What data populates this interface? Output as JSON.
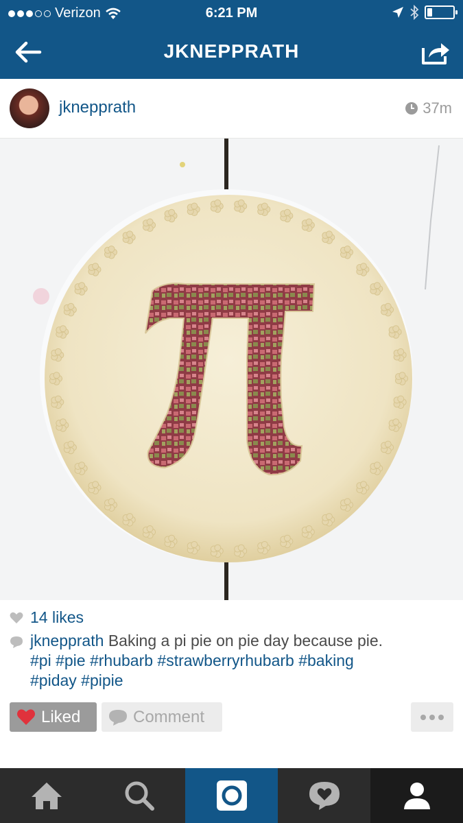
{
  "status_bar": {
    "carrier": "Verizon",
    "time": "6:21 PM",
    "signal_bars_filled": 3,
    "signal_bars_total": 5,
    "battery_level": 0.2
  },
  "nav": {
    "title": "JKNEPPRATH",
    "back_icon": "back-arrow-icon",
    "share_icon": "share-icon"
  },
  "post": {
    "username": "jknepprath",
    "time_ago": "37m",
    "likes": "14 likes",
    "caption": {
      "user": "jknepprath",
      "text": "Baking a pi pie on pie day because pie.",
      "hashtags_line1": "#pi #pie #rhubarb #strawberryrhubarb #baking",
      "hashtags_line2": "#piday #pipie"
    }
  },
  "actions": {
    "liked_label": "Liked",
    "comment_label": "Comment"
  },
  "tabs": [
    {
      "name": "home",
      "icon": "home-icon"
    },
    {
      "name": "search",
      "icon": "search-icon"
    },
    {
      "name": "camera",
      "icon": "camera-icon",
      "active": true
    },
    {
      "name": "activity",
      "icon": "activity-bubble-icon"
    },
    {
      "name": "profile",
      "icon": "profile-icon"
    }
  ],
  "colors": {
    "brand": "#125688",
    "liked_heart": "#e0323c",
    "muted": "#9b9b9b"
  }
}
